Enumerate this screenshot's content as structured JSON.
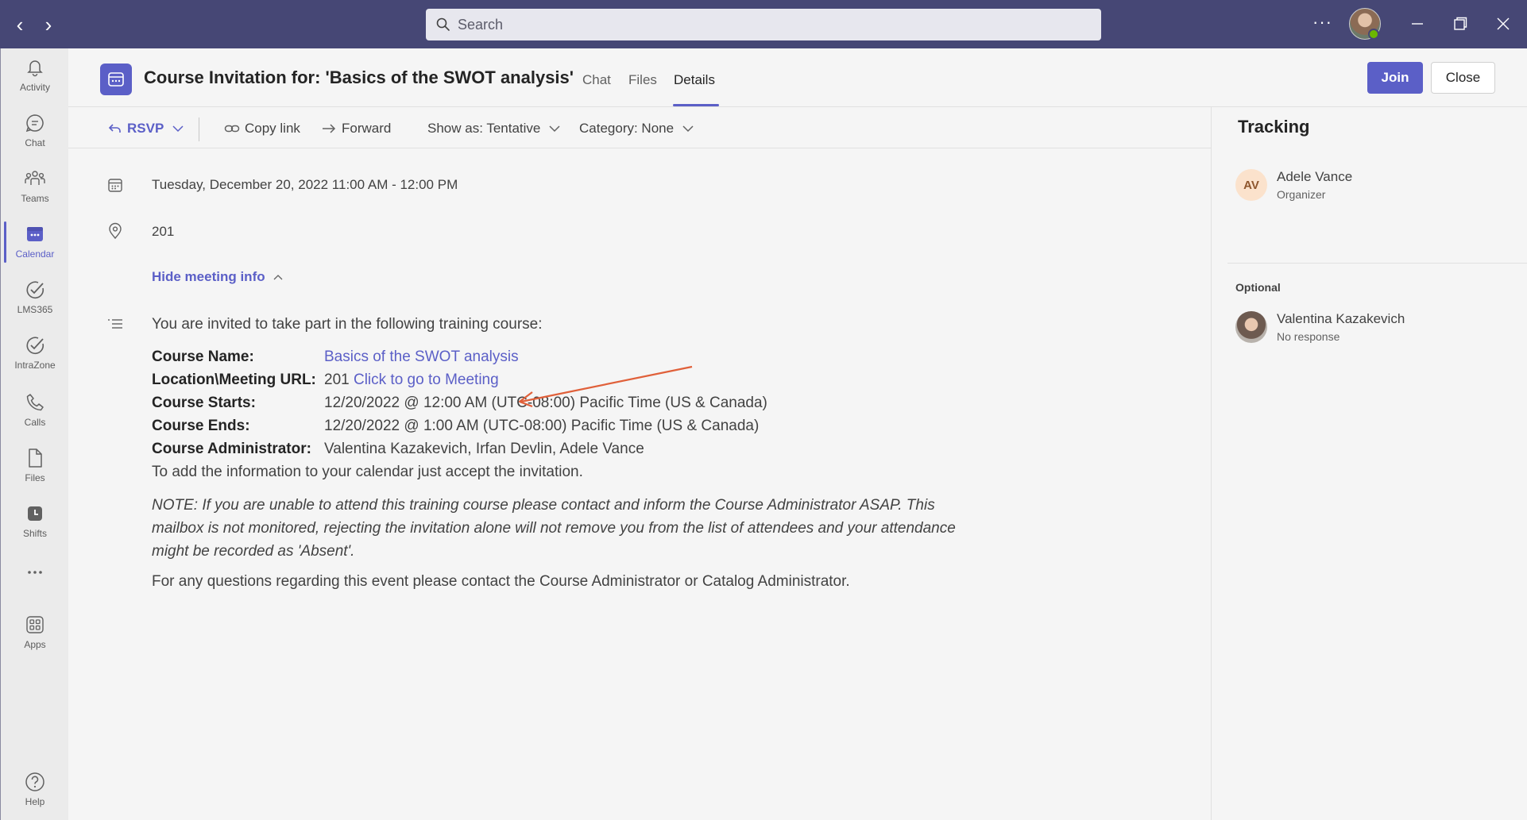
{
  "search": {
    "placeholder": "Search"
  },
  "rail": {
    "items": [
      {
        "label": "Activity",
        "icon": "bell-icon"
      },
      {
        "label": "Chat",
        "icon": "chat-icon"
      },
      {
        "label": "Teams",
        "icon": "teams-icon"
      },
      {
        "label": "Calendar",
        "icon": "calendar-icon",
        "active": true
      },
      {
        "label": "LMS365",
        "icon": "check-circle-icon"
      },
      {
        "label": "IntraZone",
        "icon": "check-circle-icon"
      },
      {
        "label": "Calls",
        "icon": "phone-icon"
      },
      {
        "label": "Files",
        "icon": "file-icon"
      },
      {
        "label": "Shifts",
        "icon": "clock-icon"
      },
      {
        "label": "",
        "icon": "more-icon"
      },
      {
        "label": "Apps",
        "icon": "apps-icon"
      },
      {
        "label": "Help",
        "icon": "help-icon"
      }
    ]
  },
  "header": {
    "title": "Course Invitation for: 'Basics of the SWOT analysis'",
    "tabs": [
      "Chat",
      "Files",
      "Details"
    ],
    "active_tab": "Details",
    "join_label": "Join",
    "close_label": "Close"
  },
  "toolbar": {
    "rsvp_label": "RSVP",
    "copy_link_label": "Copy link",
    "forward_label": "Forward",
    "show_as_label": "Show as: Tentative",
    "category_label": "Category: None"
  },
  "details": {
    "date_time": "Tuesday, December 20, 2022 11:00 AM - 12:00 PM",
    "location": "201",
    "hide_info_label": "Hide meeting info",
    "intro": "You are invited to take part in the following training course:",
    "course": {
      "name_label": "Course Name:",
      "name_value": "Basics of the SWOT analysis",
      "location_label": "Location\\Meeting URL:",
      "location_value": "201",
      "location_link": "Click to go to Meeting",
      "starts_label": "Course Starts:",
      "starts_value": "12/20/2022 @ 12:00 AM (UTC-08:00) Pacific Time (US & Canada)",
      "ends_label": "Course Ends:",
      "ends_value": "12/20/2022 @ 1:00 AM (UTC-08:00) Pacific Time (US & Canada)",
      "admin_label": "Course Administrator:",
      "admin_value": "Valentina Kazakevich, Irfan Devlin, Adele Vance"
    },
    "add_info": "To add the information to your calendar just accept the invitation.",
    "note": "NOTE: If you are unable to attend this training course please contact and inform the Course Administrator ASAP. This mailbox is not monitored, rejecting the invitation alone will not remove you from the list of attendees and your attendance might be recorded as 'Absent'.",
    "questions": "For any questions regarding this event please contact the Course Administrator or Catalog Administrator."
  },
  "tracking": {
    "title": "Tracking",
    "organizer": {
      "initials": "AV",
      "name": "Adele Vance",
      "role": "Organizer"
    },
    "optional_label": "Optional",
    "optional": [
      {
        "name": "Valentina Kazakevich",
        "status": "No response"
      }
    ]
  },
  "colors": {
    "brand": "#5b5fc7",
    "titlebar": "#464775",
    "annotation_arrow": "#e0603a",
    "presence": "#6bb700"
  }
}
